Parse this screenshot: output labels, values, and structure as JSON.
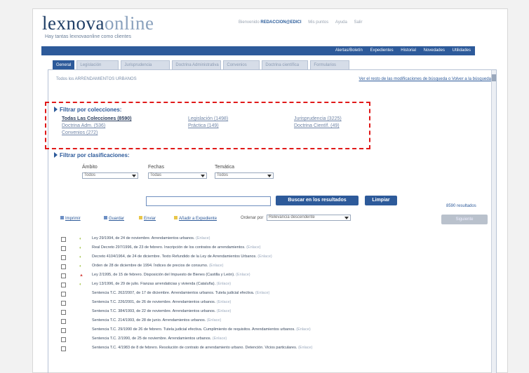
{
  "brand": {
    "logo_main": "lexnova",
    "logo_suffix": "online",
    "tagline": "Hay tantas lexnovaonline como clientes"
  },
  "userbar": {
    "welcome": "Bienvenido",
    "user": "REDACCION@EDICI",
    "links": [
      "Mis puntos",
      "Ayuda",
      "Salir"
    ]
  },
  "nav": {
    "links": [
      "Alertas/Boletín",
      "Expedientes",
      "Historial",
      "Novedades",
      "Utilidades"
    ]
  },
  "tabs": [
    {
      "label": "General",
      "active": true
    },
    {
      "label": "Legislación"
    },
    {
      "label": "Jurisprudencia"
    },
    {
      "label": "Doctrina Administrativa"
    },
    {
      "label": "Convenios"
    },
    {
      "label": "Doctrina científica"
    },
    {
      "label": "Formularios"
    }
  ],
  "breadcrumb": "Todos los ARRENDAMIENTOS URBANOS",
  "right_link": "Ver el resto de las modificaciones de búsqueda o Volver a la búsqueda",
  "collections": {
    "title": "Filtrar por colecciones:",
    "items": [
      {
        "label": "Todas Las Colecciones (8590)",
        "strong": true
      },
      {
        "label": "Doctrina Adm. (536)"
      },
      {
        "label": "Convenios (272)"
      },
      {
        "label": "Legislación (1498)"
      },
      {
        "label": "Práctica (149)"
      },
      {
        "label": "Jurisprudencia (3225)"
      },
      {
        "label": "Doctrina Científ. (49)"
      }
    ]
  },
  "classifications": {
    "title": "Filtrar por clasificaciones:",
    "filters": [
      {
        "label": "Ámbito",
        "value": "Todos"
      },
      {
        "label": "Fechas",
        "value": "Todas"
      },
      {
        "label": "Temática",
        "value": "Todos"
      }
    ]
  },
  "search": {
    "value": "",
    "button": "Buscar en los resultados",
    "clear": "Limpiar",
    "count": "8590 resultados"
  },
  "toolbar": {
    "print": "Imprimir",
    "save": "Guardar",
    "email": "Enviar",
    "add": "Añadir a Expediente",
    "order_label": "Ordenar por",
    "order_value": "Relevancia descendente",
    "gray_button": "Siguiente"
  },
  "results": [
    {
      "text": "Ley 29/1994, de 24 de noviembre. Arrendamientos urbanos.",
      "more": "(Enlace)",
      "icon": "doc"
    },
    {
      "text": "Real Decreto 297/1996, de 23 de febrero. Inscripción de los contratos de arrendamientos.",
      "more": "(Enlace)",
      "icon": "doc"
    },
    {
      "text": "Decreto 4104/1964, de 24 de diciembre. Texto Refundido de la Ley de Arrendamientos Urbanos.",
      "more": "(Enlace)",
      "icon": "doc"
    },
    {
      "text": "Orden de 28 de diciembre de 1994. Índices de precios de consumo.",
      "more": "(Enlace)",
      "icon": "doc"
    },
    {
      "text": "Ley 2/1995, de 15 de febrero. Disposición del Impuesto de Bienes (Castilla y León).",
      "more": "(Enlace)",
      "icon": "warn"
    },
    {
      "text": "Ley 13/1996, de 29 de julio. Fianzas arrendaticias y vivienda (Cataluña).",
      "more": "(Enlace)",
      "icon": "doc"
    },
    {
      "text": "Sentencia T.C. 262/2007, de 17 de diciembre. Arrendamientos urbanos. Tutela judicial efectiva.",
      "more": "(Enlace)",
      "icon": ""
    },
    {
      "text": "Sentencia T.C. 226/2001, de 26 de noviembre. Arrendamientos urbanos.",
      "more": "(Enlace)",
      "icon": ""
    },
    {
      "text": "Sentencia T.C. 384/1993, de 22 de noviembre. Arrendamientos urbanos.",
      "more": "(Enlace)",
      "icon": ""
    },
    {
      "text": "Sentencia T.C. 214/1993, de 28 de junio. Arrendamientos urbanos.",
      "more": "(Enlace)",
      "icon": ""
    },
    {
      "text": "Sentencia T.C. 29/1990 de 26 de febrero. Tutela judicial efectiva. Cumplimiento de requisitos. Arrendamientos urbanos.",
      "more": "(Enlace)",
      "icon": ""
    },
    {
      "text": "Sentencia T.C. 2/1990, de 25 de noviembre. Arrendamientos urbanos.",
      "more": "(Enlace)",
      "icon": ""
    },
    {
      "text": "Sentencia T.C. 4/1983 de 8 de febrero. Resolución de contrato de arrendamiento urbano. Detención. Vicios particulares.",
      "more": "(Enlace)",
      "icon": ""
    }
  ]
}
